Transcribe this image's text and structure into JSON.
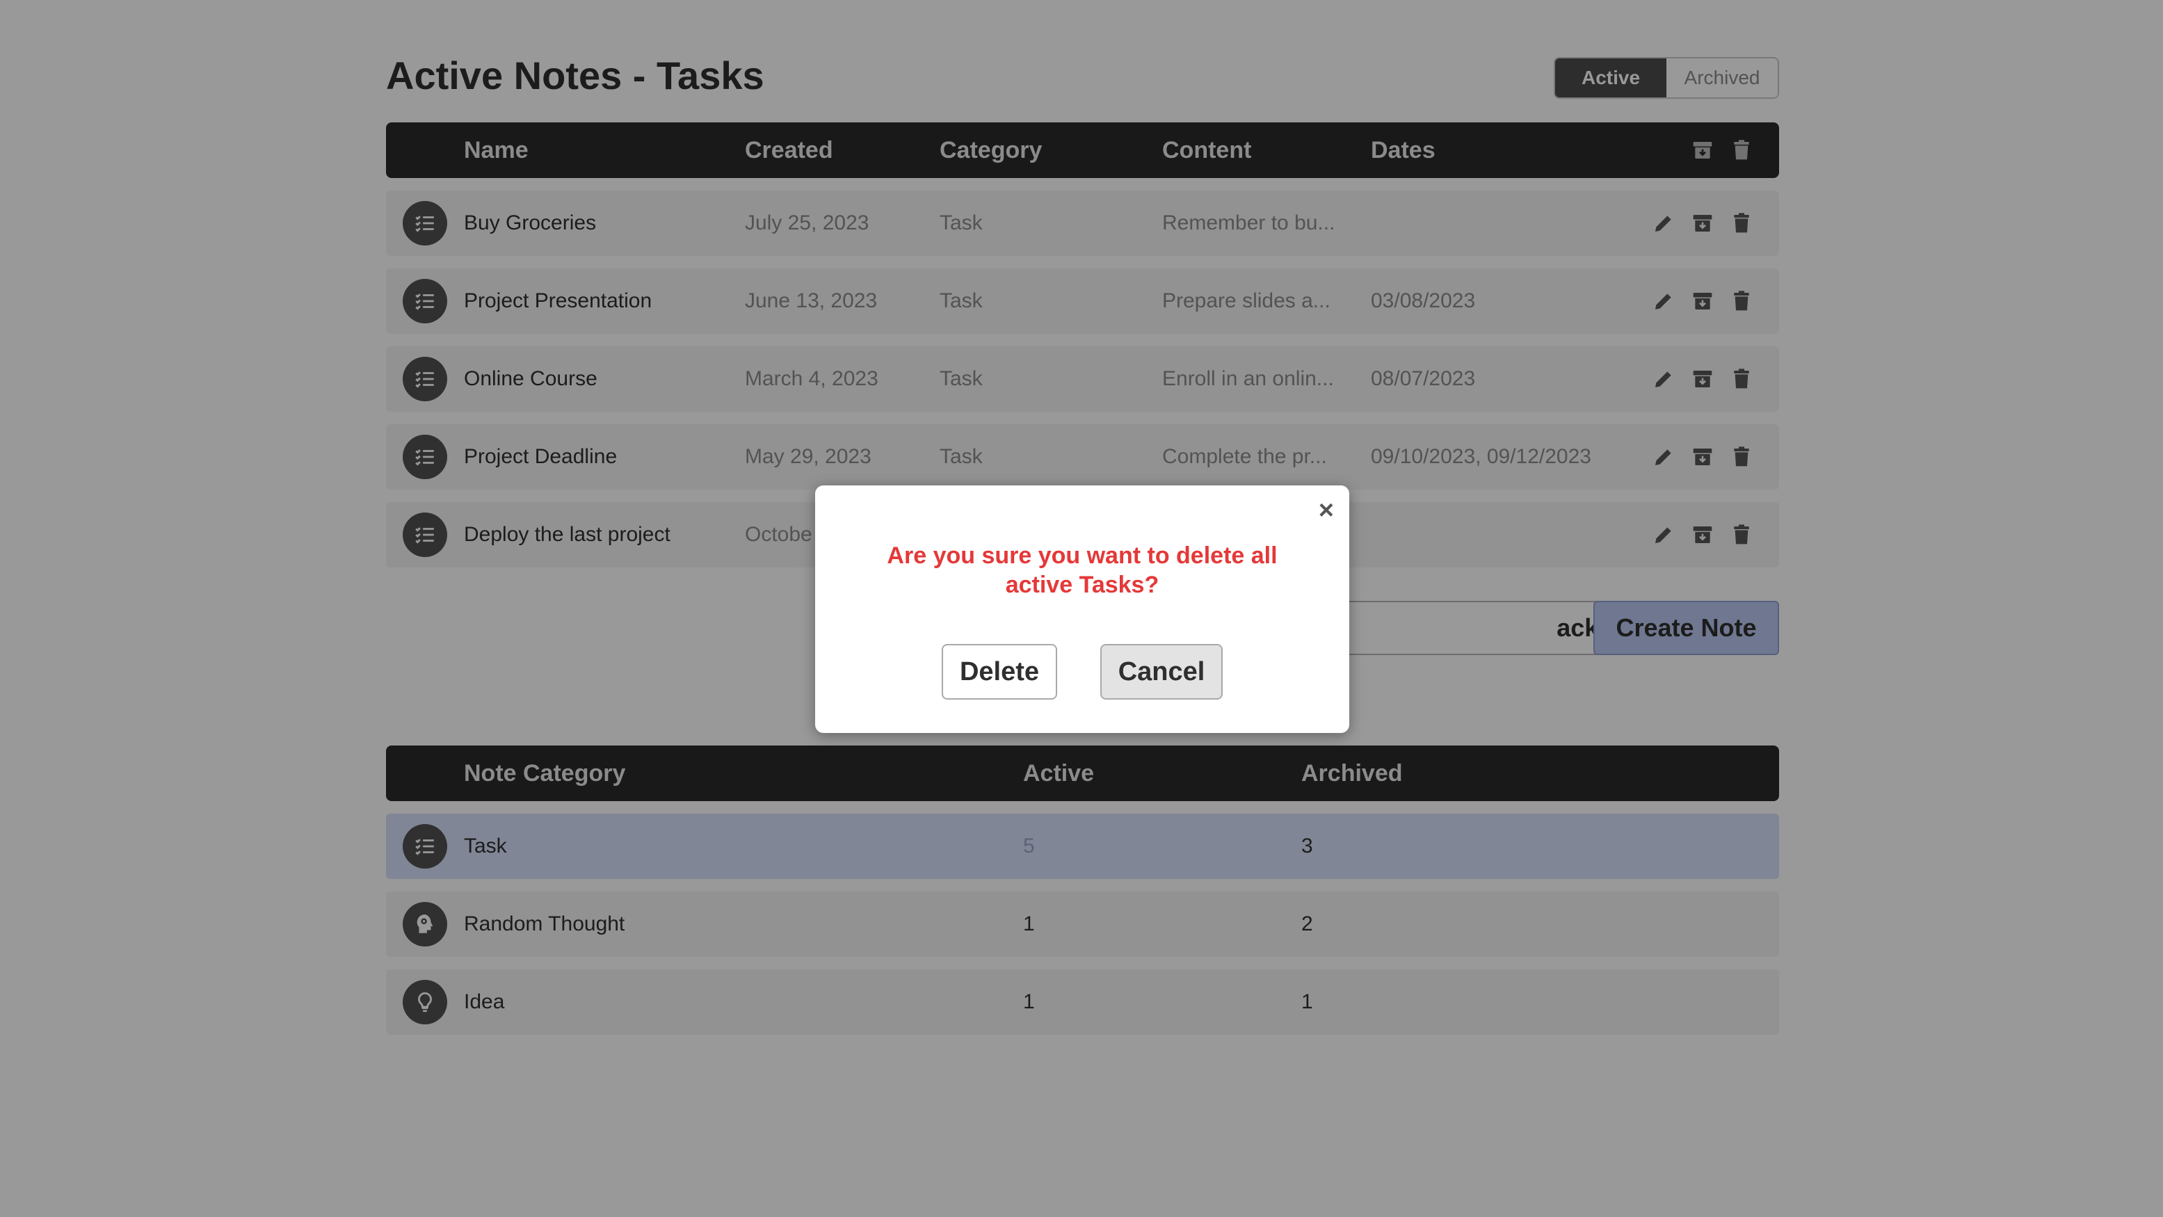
{
  "page": {
    "title": "Active Notes - Tasks",
    "toggle": {
      "active": "Active",
      "archived": "Archived",
      "selected": "Active"
    }
  },
  "notes_table": {
    "headers": [
      "Name",
      "Created",
      "Category",
      "Content",
      "Dates"
    ],
    "rows": [
      {
        "name": "Buy Groceries",
        "created": "July 25, 2023",
        "category": "Task",
        "content": "Remember to bu...",
        "dates": ""
      },
      {
        "name": "Project Presentation",
        "created": "June 13, 2023",
        "category": "Task",
        "content": "Prepare slides a...",
        "dates": "03/08/2023"
      },
      {
        "name": "Online Course",
        "created": "March 4, 2023",
        "category": "Task",
        "content": "Enroll in an onlin...",
        "dates": "08/07/2023"
      },
      {
        "name": "Project Deadline",
        "created": "May 29, 2023",
        "category": "Task",
        "content": "Complete the pr...",
        "dates": "09/10/2023, 09/12/2023"
      },
      {
        "name": "Deploy the last project",
        "created": "Octobe",
        "category": "",
        "content": "",
        "dates": ""
      }
    ]
  },
  "buttons": {
    "back": "ack to All Notes",
    "create": "Create Note"
  },
  "summary_table": {
    "headers": [
      "Note Category",
      "Active",
      "Archived"
    ],
    "rows": [
      {
        "category": "Task",
        "active": "5",
        "archived": "3",
        "icon": "checklist-icon"
      },
      {
        "category": "Random Thought",
        "active": "1",
        "archived": "2",
        "icon": "head-gear-icon"
      },
      {
        "category": "Idea",
        "active": "1",
        "archived": "1",
        "icon": "lightbulb-icon"
      }
    ]
  },
  "modal": {
    "close": "×",
    "message": "Are you sure you want to delete all active Tasks?",
    "delete_label": "Delete",
    "cancel_label": "Cancel"
  },
  "colors": {
    "header_bg": "#2a2a2a",
    "row_bg": "#f3f3f5",
    "highlight_row": "#d7e0fb",
    "danger_text": "#e53838",
    "create_button": "#b9c8f0"
  }
}
